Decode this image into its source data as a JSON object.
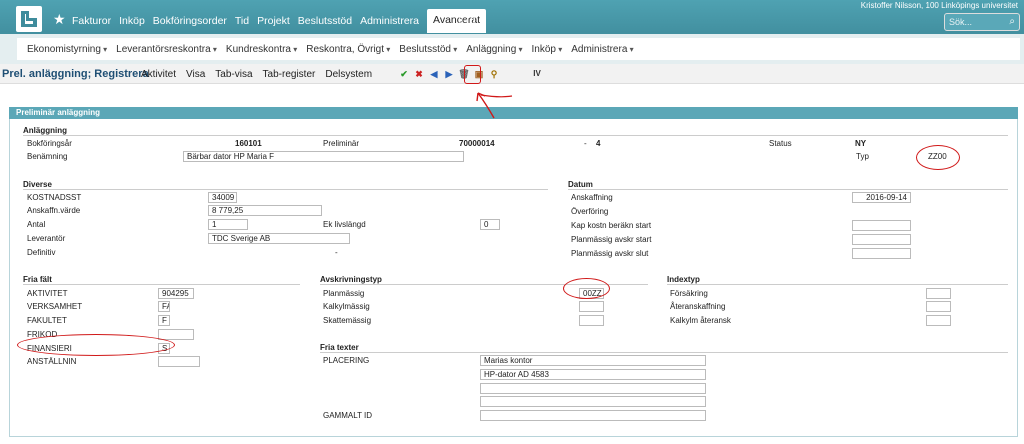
{
  "header": {
    "star": "★",
    "nav": [
      "Fakturor",
      "Inköp",
      "Bokföringsorder",
      "Tid",
      "Projekt",
      "Beslutsstöd",
      "Administrera"
    ],
    "active": "Avancerat",
    "help": "?",
    "user": "Kristoffer Nilsson, 100 Linköpings universitet",
    "search_placeholder": "Sök...",
    "search_icon": "⌕"
  },
  "subnav": [
    "Ekonomistyrning",
    "Leverantörsreskontra",
    "Kundreskontra",
    "Reskontra, Övrigt",
    "Beslutsstöd",
    "Anläggning",
    "Inköp",
    "Administrera"
  ],
  "toolbar": {
    "title": "Prel. anläggning; Registrera",
    "menu": [
      "Aktivitet",
      "Visa",
      "Tab-visa",
      "Tab-register",
      "Delsystem"
    ],
    "icons": [
      "✔",
      "✖",
      "◀",
      "▶",
      "🗑",
      "▣",
      "⚲",
      "IV"
    ]
  },
  "panel": {
    "title": "Preliminär anläggning",
    "anl": {
      "section": "Anläggning",
      "bokforingsar_label": "Bokföringsår",
      "bokforingsar": "160101",
      "prelim_label": "Preliminär",
      "prelim": "70000014",
      "dash": "-",
      "num": "4",
      "status_label": "Status",
      "status": "NY",
      "benamning_label": "Benämning",
      "benamning": "Bärbar dator HP Maria F",
      "typ_label": "Typ",
      "typ": "ZZ00"
    },
    "diverse": {
      "section": "Diverse",
      "kostnadsst_label": "KOSTNADSST",
      "kostnadsst": "34009",
      "anskaffn_label": "Anskaffn.värde",
      "anskaffn": "8 779,25",
      "antal_label": "Antal",
      "antal": "1",
      "livslangd_label": "Ek livslängd",
      "livslangd": "0",
      "leverantor_label": "Leverantör",
      "leverantor": "TDC Sverige AB",
      "definitiv_label": "Definitiv",
      "definitiv": "-"
    },
    "datum": {
      "section": "Datum",
      "anskaffning_label": "Anskaffning",
      "anskaffning": "2016-09-14",
      "overforing_label": "Överföring",
      "kap_label": "Kap kostn beräkn start",
      "planstart_label": "Planmässig avskr start",
      "planslut_label": "Planmässig avskr slut"
    },
    "fria": {
      "section": "Fria fält",
      "aktivitet_label": "AKTIVITET",
      "aktivitet": "904295",
      "verksamhet_label": "VERKSAMHET",
      "verksamhet": "FA",
      "fakultet_label": "FAKULTET",
      "fakultet": "F",
      "frikod_label": "FRIKOD",
      "frikod": "",
      "finansieri_label": "FINANSIERI",
      "finansieri": "S",
      "anstallnin_label": "ANSTÄLLNIN",
      "anstallnin": ""
    },
    "avskr": {
      "section": "Avskrivningstyp",
      "plan_label": "Planmässig",
      "plan": "00ZZ",
      "kalkyl_label": "Kalkylmässig",
      "skatt_label": "Skattemässig"
    },
    "index": {
      "section": "Indextyp",
      "forsakring_label": "Försäkring",
      "ateransk_label": "Återanskaffning",
      "kalkylm_label": "Kalkylm återansk"
    },
    "texter": {
      "section": "Fria texter",
      "placering_label": "PLACERING",
      "lines": [
        "Marias kontor",
        "HP-dator AD 4583",
        "",
        ""
      ],
      "gammalt_label": "GAMMALT ID",
      "gammalt": ""
    }
  }
}
